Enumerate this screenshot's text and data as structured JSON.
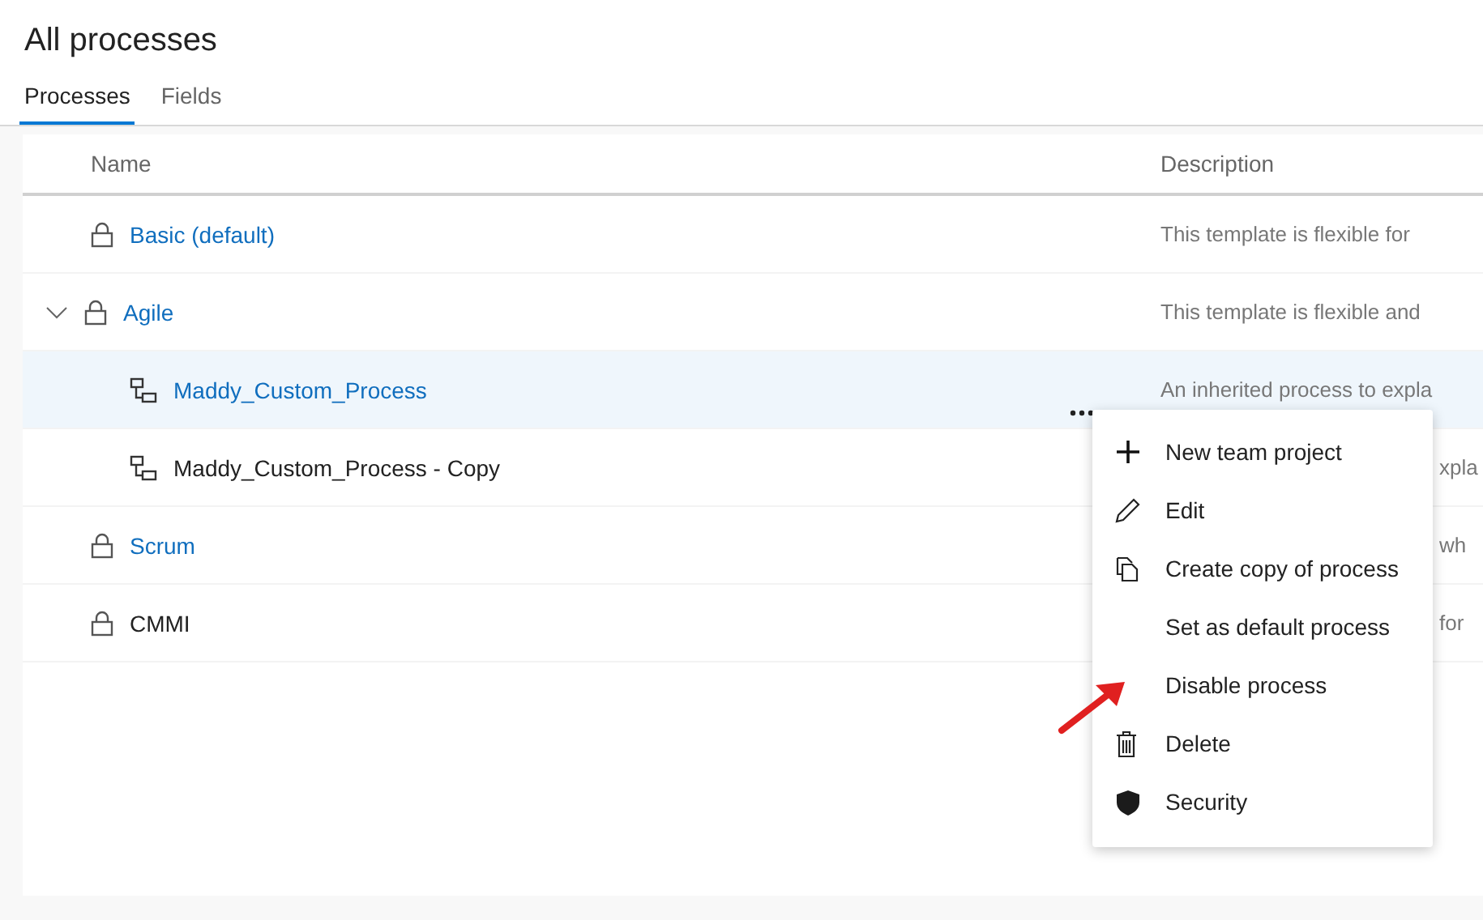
{
  "page": {
    "title": "All processes"
  },
  "tabs": [
    {
      "label": "Processes",
      "selected": true
    },
    {
      "label": "Fields",
      "selected": false
    }
  ],
  "table": {
    "columns": [
      "Name",
      "Description"
    ],
    "rows": [
      {
        "name": "Basic (default)",
        "kind": "system",
        "link": true,
        "selected": false,
        "description": "This template is flexible for"
      },
      {
        "name": "Agile",
        "kind": "system",
        "link": true,
        "selected": false,
        "expanded": true,
        "description": "This template is flexible and",
        "children": [
          {
            "name": "Maddy_Custom_Process",
            "kind": "inherited",
            "link": true,
            "selected": true,
            "description": "An inherited process to expla"
          },
          {
            "name": "Maddy_Custom_Process - Copy",
            "kind": "inherited",
            "link": false,
            "selected": false,
            "description_tail": "xpla"
          }
        ]
      },
      {
        "name": "Scrum",
        "kind": "system",
        "link": true,
        "selected": false,
        "description_tail": "wh"
      },
      {
        "name": "CMMI",
        "kind": "system",
        "link": false,
        "selected": false,
        "description_tail": "for"
      }
    ]
  },
  "context_menu": {
    "items": [
      {
        "label": "New team project",
        "kind": "add"
      },
      {
        "label": "Edit",
        "kind": "edit"
      },
      {
        "label": "Create copy of process",
        "kind": "copy"
      },
      {
        "label": "Set as default process"
      },
      {
        "label": "Disable process"
      },
      {
        "label": "Delete",
        "kind": "delete"
      },
      {
        "label": "Security",
        "kind": "security"
      }
    ]
  }
}
